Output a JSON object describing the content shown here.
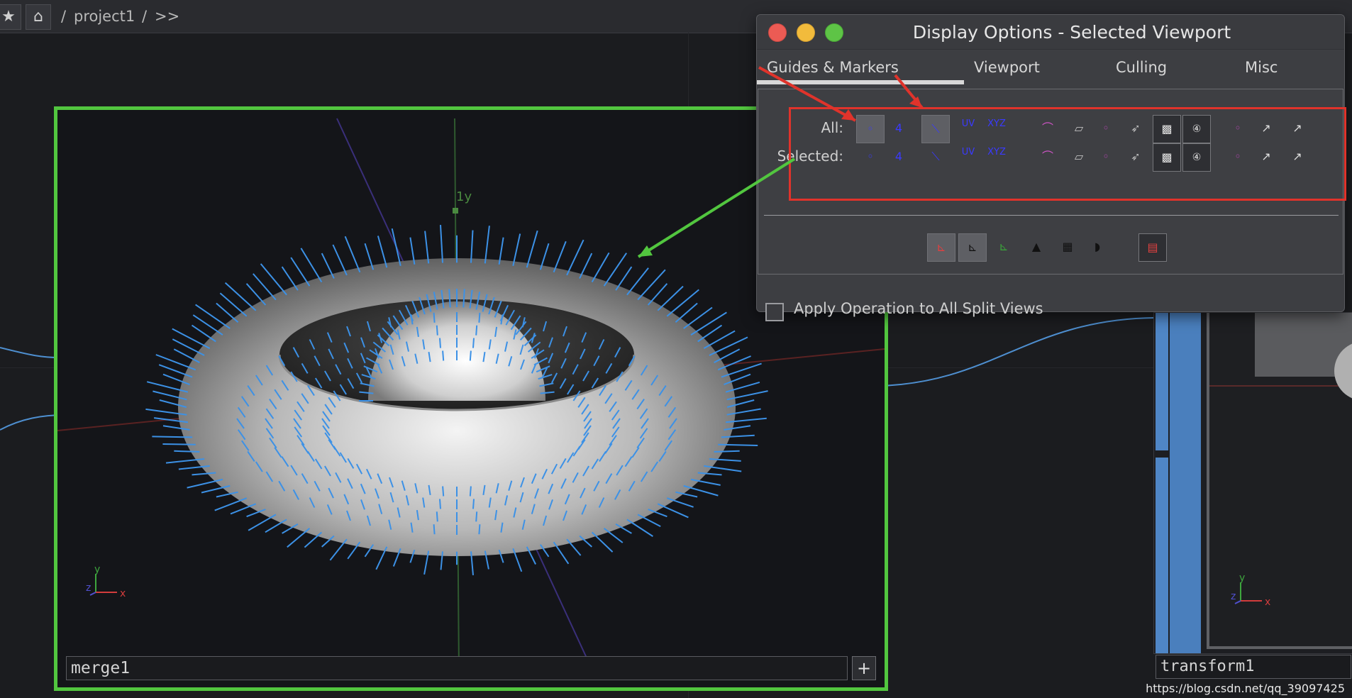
{
  "topbar": {
    "star_icon": "star-icon",
    "home_icon": "home-icon",
    "path_sep1": "/",
    "path": "project1",
    "path_sep2": "/",
    "path_more": ">>"
  },
  "viewport_left": {
    "node_name": "merge1",
    "axis_label_y": "1y",
    "gizmo": {
      "y": "y",
      "x": "x",
      "z": "z"
    },
    "plus_label": "+"
  },
  "viewport_right": {
    "node_name": "transform1",
    "gizmo": {
      "y": "y",
      "x": "x",
      "z": "z"
    }
  },
  "dialog": {
    "title": "Display Options - Selected Viewport",
    "tabs": [
      "Guides & Markers",
      "Viewport",
      "Culling",
      "Misc"
    ],
    "rows": [
      "All:",
      "Selected:"
    ],
    "marker_icons": {
      "uv": "UV",
      "xyz": "XYZ",
      "num": "4"
    },
    "apply_label": "Apply Operation to All Split Views",
    "apply_checked": false
  },
  "annotation_colors": {
    "red": "#e0332b",
    "green": "#52c63f"
  },
  "watermark": "https://blog.csdn.net/qq_39097425"
}
